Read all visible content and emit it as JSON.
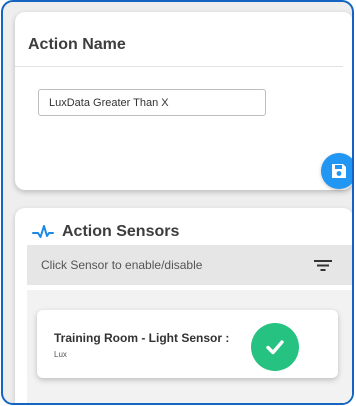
{
  "action_card": {
    "title": "Action Name",
    "name_value": "LuxData Greater Than X",
    "save_icon": "floppy-disk-icon"
  },
  "sensors_card": {
    "title": "Action Sensors",
    "header_icon": "activity-pulse-icon",
    "filter_text": "Click Sensor to enable/disable",
    "filter_icon": "filter-icon",
    "items": [
      {
        "name": "Training Room - Light Sensor :",
        "unit": "Lux",
        "enabled": true,
        "status_icon": "check-icon"
      }
    ]
  },
  "colors": {
    "frame_border": "#1565c0",
    "save_button": "#2196f3",
    "enabled_check": "#26c281",
    "pulse_icon": "#1e88e5"
  }
}
